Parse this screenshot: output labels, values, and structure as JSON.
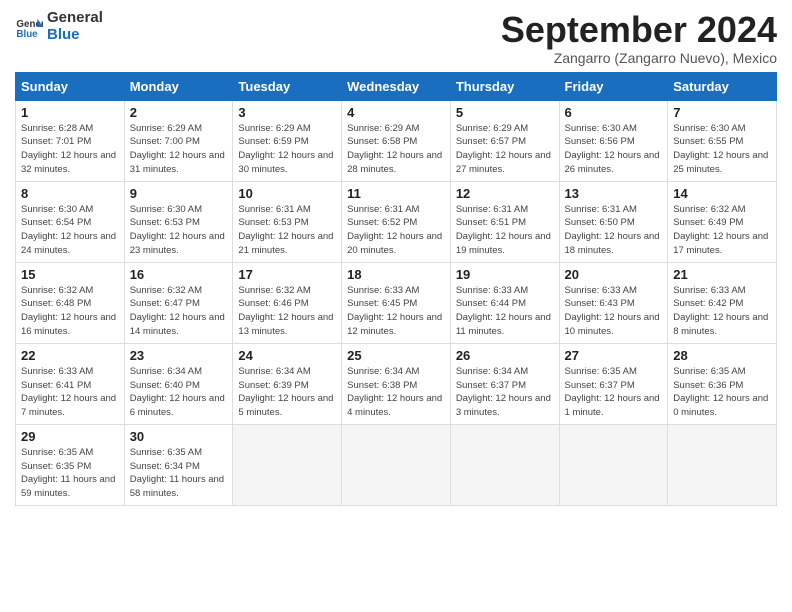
{
  "logo": {
    "line1": "General",
    "line2": "Blue"
  },
  "title": "September 2024",
  "subtitle": "Zangarro (Zangarro Nuevo), Mexico",
  "headers": [
    "Sunday",
    "Monday",
    "Tuesday",
    "Wednesday",
    "Thursday",
    "Friday",
    "Saturday"
  ],
  "weeks": [
    [
      {
        "day": "1",
        "sunrise": "6:28 AM",
        "sunset": "7:01 PM",
        "daylight": "12 hours and 32 minutes."
      },
      {
        "day": "2",
        "sunrise": "6:29 AM",
        "sunset": "7:00 PM",
        "daylight": "12 hours and 31 minutes."
      },
      {
        "day": "3",
        "sunrise": "6:29 AM",
        "sunset": "6:59 PM",
        "daylight": "12 hours and 30 minutes."
      },
      {
        "day": "4",
        "sunrise": "6:29 AM",
        "sunset": "6:58 PM",
        "daylight": "12 hours and 28 minutes."
      },
      {
        "day": "5",
        "sunrise": "6:29 AM",
        "sunset": "6:57 PM",
        "daylight": "12 hours and 27 minutes."
      },
      {
        "day": "6",
        "sunrise": "6:30 AM",
        "sunset": "6:56 PM",
        "daylight": "12 hours and 26 minutes."
      },
      {
        "day": "7",
        "sunrise": "6:30 AM",
        "sunset": "6:55 PM",
        "daylight": "12 hours and 25 minutes."
      }
    ],
    [
      {
        "day": "8",
        "sunrise": "6:30 AM",
        "sunset": "6:54 PM",
        "daylight": "12 hours and 24 minutes."
      },
      {
        "day": "9",
        "sunrise": "6:30 AM",
        "sunset": "6:53 PM",
        "daylight": "12 hours and 23 minutes."
      },
      {
        "day": "10",
        "sunrise": "6:31 AM",
        "sunset": "6:53 PM",
        "daylight": "12 hours and 21 minutes."
      },
      {
        "day": "11",
        "sunrise": "6:31 AM",
        "sunset": "6:52 PM",
        "daylight": "12 hours and 20 minutes."
      },
      {
        "day": "12",
        "sunrise": "6:31 AM",
        "sunset": "6:51 PM",
        "daylight": "12 hours and 19 minutes."
      },
      {
        "day": "13",
        "sunrise": "6:31 AM",
        "sunset": "6:50 PM",
        "daylight": "12 hours and 18 minutes."
      },
      {
        "day": "14",
        "sunrise": "6:32 AM",
        "sunset": "6:49 PM",
        "daylight": "12 hours and 17 minutes."
      }
    ],
    [
      {
        "day": "15",
        "sunrise": "6:32 AM",
        "sunset": "6:48 PM",
        "daylight": "12 hours and 16 minutes."
      },
      {
        "day": "16",
        "sunrise": "6:32 AM",
        "sunset": "6:47 PM",
        "daylight": "12 hours and 14 minutes."
      },
      {
        "day": "17",
        "sunrise": "6:32 AM",
        "sunset": "6:46 PM",
        "daylight": "12 hours and 13 minutes."
      },
      {
        "day": "18",
        "sunrise": "6:33 AM",
        "sunset": "6:45 PM",
        "daylight": "12 hours and 12 minutes."
      },
      {
        "day": "19",
        "sunrise": "6:33 AM",
        "sunset": "6:44 PM",
        "daylight": "12 hours and 11 minutes."
      },
      {
        "day": "20",
        "sunrise": "6:33 AM",
        "sunset": "6:43 PM",
        "daylight": "12 hours and 10 minutes."
      },
      {
        "day": "21",
        "sunrise": "6:33 AM",
        "sunset": "6:42 PM",
        "daylight": "12 hours and 8 minutes."
      }
    ],
    [
      {
        "day": "22",
        "sunrise": "6:33 AM",
        "sunset": "6:41 PM",
        "daylight": "12 hours and 7 minutes."
      },
      {
        "day": "23",
        "sunrise": "6:34 AM",
        "sunset": "6:40 PM",
        "daylight": "12 hours and 6 minutes."
      },
      {
        "day": "24",
        "sunrise": "6:34 AM",
        "sunset": "6:39 PM",
        "daylight": "12 hours and 5 minutes."
      },
      {
        "day": "25",
        "sunrise": "6:34 AM",
        "sunset": "6:38 PM",
        "daylight": "12 hours and 4 minutes."
      },
      {
        "day": "26",
        "sunrise": "6:34 AM",
        "sunset": "6:37 PM",
        "daylight": "12 hours and 3 minutes."
      },
      {
        "day": "27",
        "sunrise": "6:35 AM",
        "sunset": "6:37 PM",
        "daylight": "12 hours and 1 minute."
      },
      {
        "day": "28",
        "sunrise": "6:35 AM",
        "sunset": "6:36 PM",
        "daylight": "12 hours and 0 minutes."
      }
    ],
    [
      {
        "day": "29",
        "sunrise": "6:35 AM",
        "sunset": "6:35 PM",
        "daylight": "11 hours and 59 minutes."
      },
      {
        "day": "30",
        "sunrise": "6:35 AM",
        "sunset": "6:34 PM",
        "daylight": "11 hours and 58 minutes."
      },
      null,
      null,
      null,
      null,
      null
    ]
  ]
}
